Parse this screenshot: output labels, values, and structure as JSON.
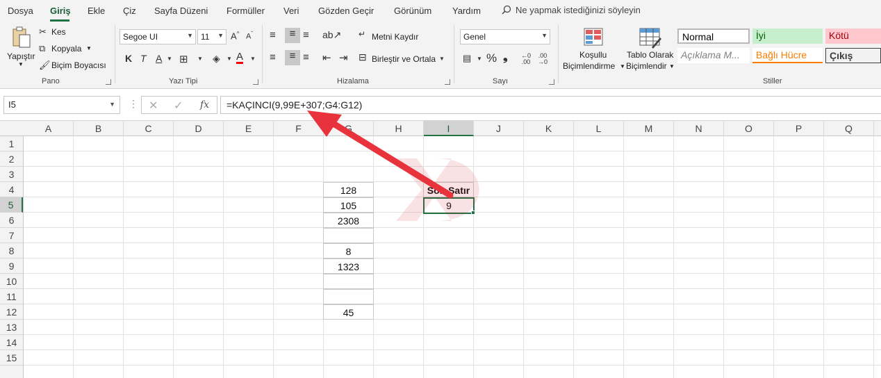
{
  "menu": {
    "items": [
      "Dosya",
      "Giriş",
      "Ekle",
      "Çiz",
      "Sayfa Düzeni",
      "Formüller",
      "Veri",
      "Gözden Geçir",
      "Görünüm",
      "Yardım"
    ],
    "active": "Giriş",
    "tell_me": "Ne yapmak istediğinizi söyleyin"
  },
  "ribbon": {
    "clipboard": {
      "paste": "Yapıştır",
      "cut": "Kes",
      "copy": "Kopyala",
      "format_painter": "Biçim Boyacısı",
      "group_label": "Pano"
    },
    "font": {
      "name": "Segoe UI",
      "size": "11",
      "bold": "K",
      "italic": "T",
      "underline": "A",
      "group_label": "Yazı Tipi"
    },
    "alignment": {
      "wrap_text": "Metni Kaydır",
      "merge_center": "Birleştir ve Ortala",
      "group_label": "Hizalama"
    },
    "number": {
      "format": "Genel",
      "percent": "%",
      "comma": "❟",
      "group_label": "Sayı"
    },
    "styles": {
      "conditional_line1": "Koşullu",
      "conditional_line2": "Biçimlendirme",
      "table_line1": "Tablo Olarak",
      "table_line2": "Biçimlendir",
      "normal": "Normal",
      "good": "İyi",
      "bad": "Kötü",
      "explanatory": "Açıklama M...",
      "linked_cell": "Bağlı Hücre",
      "output": "Çıkış",
      "group_label": "Stiller"
    }
  },
  "formula_bar": {
    "name_box": "I5",
    "formula": "=KAÇINCI(9,99E+307;G4:G12)"
  },
  "columns": [
    "A",
    "B",
    "C",
    "D",
    "E",
    "F",
    "G",
    "H",
    "I",
    "J",
    "K",
    "L",
    "M",
    "N",
    "O",
    "P",
    "Q"
  ],
  "rows": [
    "1",
    "2",
    "3",
    "4",
    "5",
    "6",
    "7",
    "8",
    "9",
    "10",
    "11",
    "12",
    "13",
    "14",
    "15"
  ],
  "selected_column": "I",
  "selected_row": "5",
  "g_values": [
    "128",
    "105",
    "2308",
    "",
    "8",
    "1323",
    "",
    "",
    "45"
  ],
  "header_cell": "Son Satır",
  "result_cell": "9",
  "colors": {
    "accent": "#217346",
    "arrow": "#e8333c",
    "good_bg": "#c6efce",
    "bad_bg": "#ffc7ce",
    "linked_text": "#fa7d00"
  }
}
